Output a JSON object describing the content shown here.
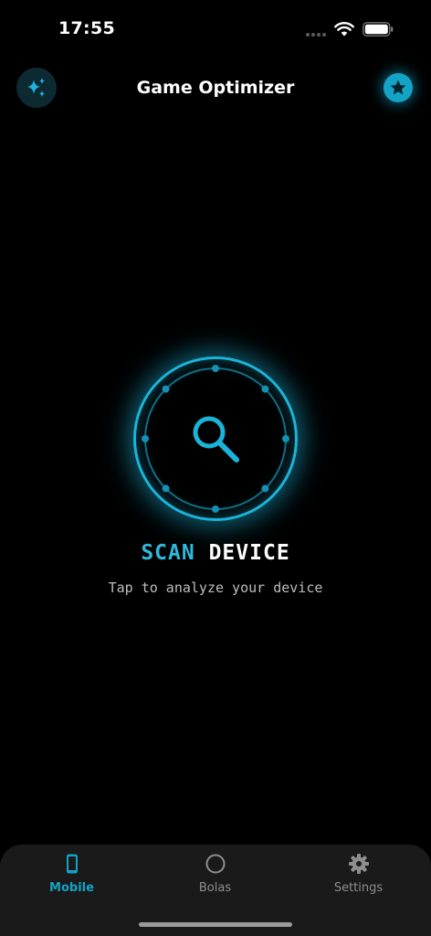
{
  "status_bar": {
    "time": "17:55"
  },
  "header": {
    "title": "Game Optimizer"
  },
  "scan": {
    "title_word1": "SCAN",
    "title_word2": "DEVICE",
    "subtitle": "Tap to analyze your device"
  },
  "tabs": [
    {
      "label": "Mobile",
      "icon": "phone-icon",
      "active": true
    },
    {
      "label": "Bolas",
      "icon": "circle-icon",
      "active": false
    },
    {
      "label": "Settings",
      "icon": "gear-icon",
      "active": false
    }
  ],
  "colors": {
    "accent": "#14a3c7",
    "background": "#000000",
    "tab_bar": "#1a1a1a",
    "inactive": "#8e8e8e"
  }
}
